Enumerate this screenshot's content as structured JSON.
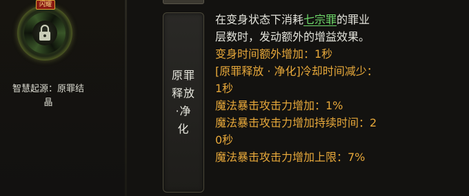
{
  "skill": {
    "badge": "闪耀",
    "origin_label": "智慧起源：原罪结晶",
    "origin_line1": "智慧起源：原罪结",
    "origin_line2": "晶",
    "name_lines": [
      "原罪",
      "释放",
      "·净",
      "化"
    ]
  },
  "description": {
    "intro_pre": "在变身状态下消耗",
    "intro_keyword": "七宗罪",
    "intro_post": "的罪业",
    "intro_line2": "层数时，发动额外的增益效果。",
    "effects": [
      "变身时间额外增加：1秒",
      "[原罪释放 · 净化]冷却时间减少：",
      "1秒",
      "魔法暴击攻击力增加：1%",
      "魔法暴击攻击力增加持续时间：2",
      "0秒",
      "魔法暴击攻击力增加上限：7%"
    ]
  },
  "colors": {
    "effect_text": "#e7a83a",
    "keyword": "#6fd96a",
    "body_text": "#e4e4dc"
  },
  "icons": {
    "skill_icon": "lock-swirl-icon"
  }
}
